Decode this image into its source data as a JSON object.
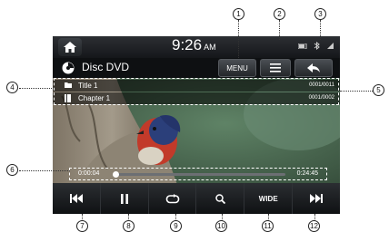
{
  "status_bar": {
    "time": "9:26",
    "ampm": "AM"
  },
  "title_bar": {
    "source_title": "Disc DVD",
    "menu_label": "MENU"
  },
  "info": {
    "title_label": "Title 1",
    "title_number": "0001/0011",
    "chapter_label": "Chapter 1",
    "chapter_number": "0001/0002"
  },
  "playback": {
    "elapsed": "0:00:04",
    "total": "0:24:45",
    "progress_fraction": 0.015
  },
  "controls": {
    "wide_label": "WIDE"
  },
  "callouts": {
    "c1": "1",
    "c2": "2",
    "c3": "3",
    "c4": "4",
    "c5": "5",
    "c6": "6",
    "c7": "7",
    "c8": "8",
    "c9": "9",
    "c10": "10",
    "c11": "11",
    "c12": "12"
  },
  "icons": [
    "home-icon",
    "disc-icon",
    "list-icon",
    "back-icon",
    "folder-icon",
    "chapter-icon",
    "previous-icon",
    "pause-icon",
    "repeat-icon",
    "search-icon",
    "next-icon"
  ]
}
